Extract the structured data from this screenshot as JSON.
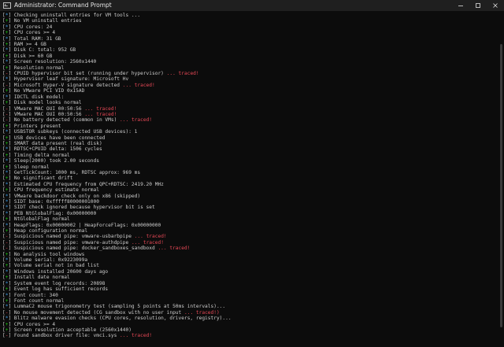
{
  "window": {
    "title": "Administrator: Command Prompt",
    "icon": "terminal-icon",
    "controls": [
      "minimize-icon",
      "maximize-icon",
      "close-icon"
    ]
  },
  "colors": {
    "background": "#0c0c0c",
    "text": "#cccccc",
    "plus": "#16c60c",
    "minus": "#e74856",
    "info": "#3a96dd",
    "traced": "#e74856"
  },
  "lines": [
    {
      "sym": "*",
      "text": "Checking uninstall entries for VM tools ...",
      "flag": ""
    },
    {
      "sym": "+",
      "text": "No VM uninstall entries",
      "flag": ""
    },
    {
      "sym": "*",
      "text": "CPU cores: 24",
      "flag": ""
    },
    {
      "sym": "+",
      "text": "CPU cores >= 4",
      "flag": ""
    },
    {
      "sym": "*",
      "text": "Total RAM: 31 GB",
      "flag": ""
    },
    {
      "sym": "+",
      "text": "RAM >= 4 GB",
      "flag": ""
    },
    {
      "sym": "*",
      "text": "Disk C: total: 952 GB",
      "flag": ""
    },
    {
      "sym": "+",
      "text": "Disk >= 60 GB",
      "flag": ""
    },
    {
      "sym": "*",
      "text": "Screen resolution: 2560x1440",
      "flag": ""
    },
    {
      "sym": "+",
      "text": "Resolution normal",
      "flag": ""
    },
    {
      "sym": "-",
      "text": "CPUID hypervisor bit set (running under hypervisor)",
      "flag": " ... traced!"
    },
    {
      "sym": "*",
      "text": "Hypervisor leaf signature: Microsoft Hv",
      "flag": ""
    },
    {
      "sym": "-",
      "text": "Microsoft Hyper-V signature detected",
      "flag": " ... traced!"
    },
    {
      "sym": "+",
      "text": "No VMware PCI VID 0x15AD",
      "flag": ""
    },
    {
      "sym": "*",
      "text": "IDCTL disk model:",
      "flag": ""
    },
    {
      "sym": "+",
      "text": "Disk model looks normal",
      "flag": ""
    },
    {
      "sym": "-",
      "text": "VMware MAC OUI 00:50:56",
      "flag": " ... traced!"
    },
    {
      "sym": "-",
      "text": "VMware MAC OUI 00:50:56",
      "flag": " ... traced!"
    },
    {
      "sym": "-",
      "text": "No battery detected (common in VMs)",
      "flag": " ... traced!"
    },
    {
      "sym": "+",
      "text": "Printers present",
      "flag": ""
    },
    {
      "sym": "*",
      "text": "USBSTOR subkeys (connected USB devices): 1",
      "flag": ""
    },
    {
      "sym": "+",
      "text": "USB devices have been connected",
      "flag": ""
    },
    {
      "sym": "+",
      "text": "SMART data present (real disk)",
      "flag": ""
    },
    {
      "sym": "*",
      "text": "RDTSC+CPUID delta: 1506 cycles",
      "flag": ""
    },
    {
      "sym": "+",
      "text": "Timing delta normal",
      "flag": ""
    },
    {
      "sym": "*",
      "text": "Sleep(2000) took 2.00 seconds",
      "flag": ""
    },
    {
      "sym": "+",
      "text": "Sleep normal",
      "flag": ""
    },
    {
      "sym": "*",
      "text": "GetTickCount: 1000 ms, RDTSC approx: 969 ms",
      "flag": ""
    },
    {
      "sym": "+",
      "text": "No significant drift",
      "flag": ""
    },
    {
      "sym": "*",
      "text": "Estimated CPU frequency from QPC+RDTSC: 2419.20 MHz",
      "flag": ""
    },
    {
      "sym": "+",
      "text": "CPU frequency estimate normal",
      "flag": ""
    },
    {
      "sym": "*",
      "text": "VMware backdoor check only on x86 (skipped)",
      "flag": ""
    },
    {
      "sym": "*",
      "text": "SIDT base: 0xfffff80000001000",
      "flag": ""
    },
    {
      "sym": "*",
      "text": "SIDT check ignored because hypervisor bit is set",
      "flag": ""
    },
    {
      "sym": "*",
      "text": "PEB NtGlobalFlag: 0x00000000",
      "flag": ""
    },
    {
      "sym": "+",
      "text": "NtGlobalFlag normal",
      "flag": ""
    },
    {
      "sym": "*",
      "text": "HeapFlags: 0x00000002 | HeapForceFlags: 0x00000000",
      "flag": ""
    },
    {
      "sym": "+",
      "text": "Heap configuration normal",
      "flag": ""
    },
    {
      "sym": "-",
      "text": "Suspicious named pipe: vmware-usbarbpipe",
      "flag": " ... traced!"
    },
    {
      "sym": "-",
      "text": "Suspicious named pipe: vmware-authdpipe",
      "flag": " ... traced!"
    },
    {
      "sym": "-",
      "text": "Suspicious named pipe: docker_sandboxes_sandboxd",
      "flag": " ... traced!"
    },
    {
      "sym": "+",
      "text": "No analysis tool windows",
      "flag": ""
    },
    {
      "sym": "*",
      "text": "Volume serial: 0x9223099a",
      "flag": ""
    },
    {
      "sym": "+",
      "text": "Volume serial not in bad list",
      "flag": ""
    },
    {
      "sym": "*",
      "text": "Windows installed 20600 days ago",
      "flag": ""
    },
    {
      "sym": "+",
      "text": "Install date normal",
      "flag": ""
    },
    {
      "sym": "*",
      "text": "System event log records: 20898",
      "flag": ""
    },
    {
      "sym": "+",
      "text": "Event log has sufficient records",
      "flag": ""
    },
    {
      "sym": "*",
      "text": "Font count: 340",
      "flag": ""
    },
    {
      "sym": "+",
      "text": "Font count normal",
      "flag": ""
    },
    {
      "sym": "*",
      "text": "LummaC2 mouse trigonometry test (sampling 5 points at 50ms intervals)...",
      "flag": ""
    },
    {
      "sym": "-",
      "text": "No mouse movement detected (CG sandbox with no user input",
      "flag": " ... traced!)"
    },
    {
      "sym": "*",
      "text": "Blitz malware evasion checks (CPU cores, resolution, drivers, registry)...",
      "flag": ""
    },
    {
      "sym": "+",
      "text": "CPU cores >= 4",
      "flag": ""
    },
    {
      "sym": "+",
      "text": "Screen resolution acceptable (2560x1440)",
      "flag": ""
    },
    {
      "sym": "-",
      "text": "Found sandbox driver file: vmci.sys",
      "flag": " ... traced!"
    }
  ]
}
